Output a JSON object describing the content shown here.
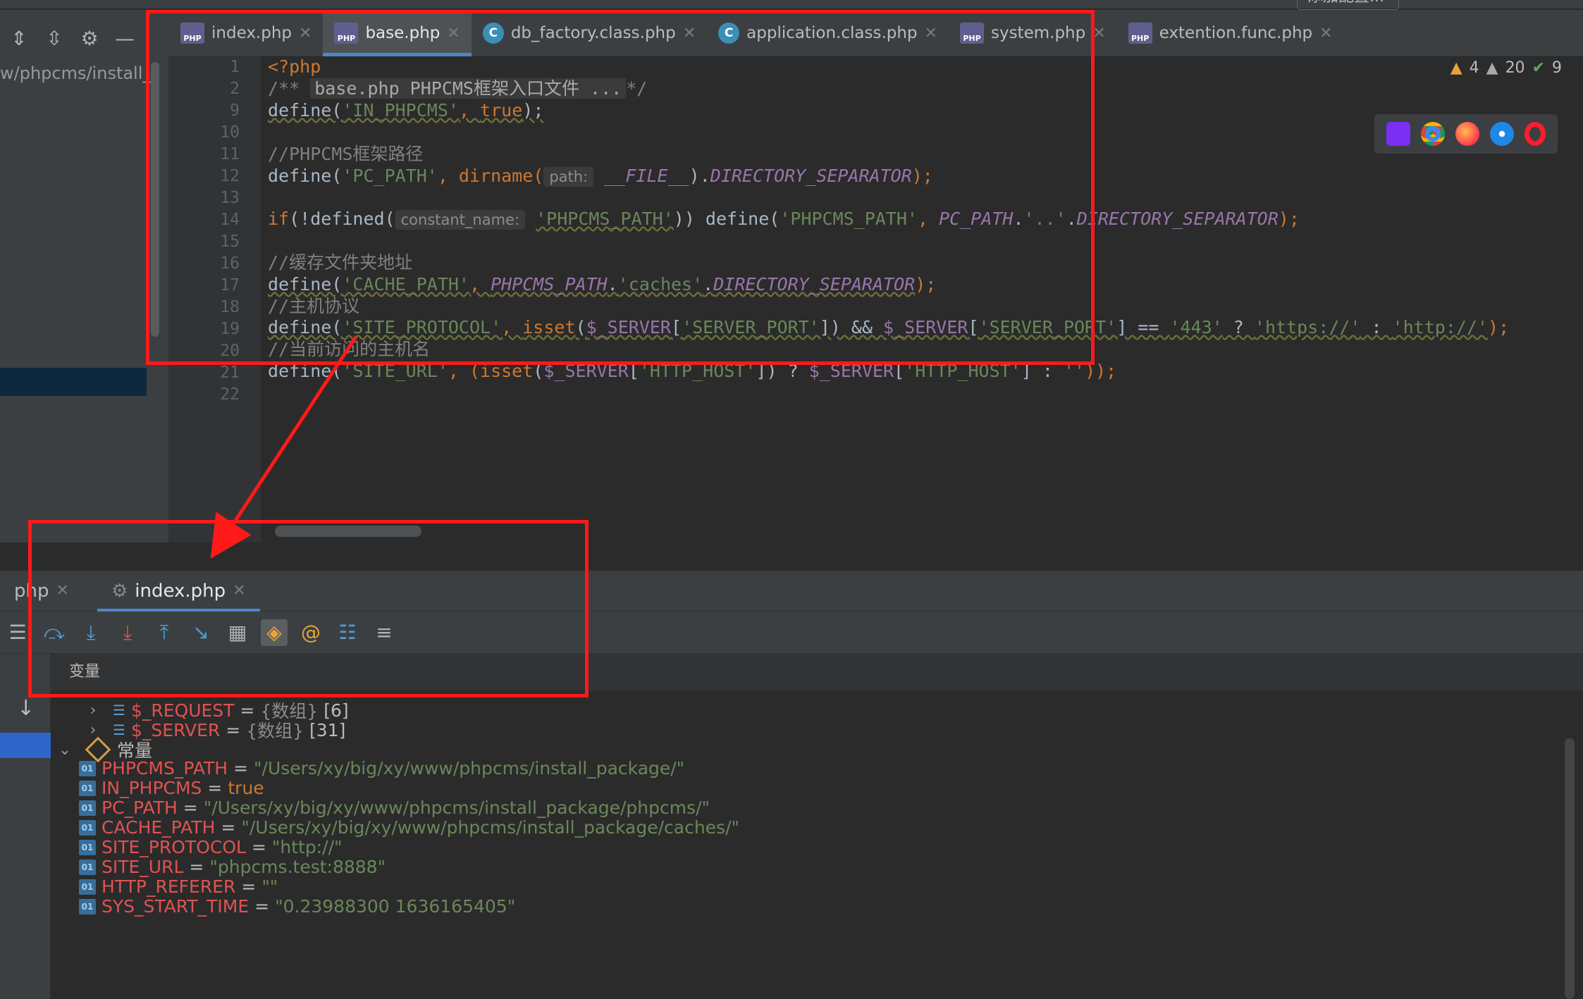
{
  "toolbar": {
    "top_button": "添加配置..."
  },
  "tabs": [
    {
      "label": "index.php",
      "type": "php"
    },
    {
      "label": "base.php",
      "type": "php",
      "active": true
    },
    {
      "label": "db_factory.class.php",
      "type": "class"
    },
    {
      "label": "application.class.php",
      "type": "class"
    },
    {
      "label": "system.php",
      "type": "php"
    },
    {
      "label": "extention.func.php",
      "type": "php"
    }
  ],
  "project": {
    "path": "w/phpcms/install_"
  },
  "editor": {
    "line_numbers": [
      "1",
      "2",
      "9",
      "10",
      "11",
      "12",
      "13",
      "14",
      "15",
      "16",
      "17",
      "18",
      "19",
      "20",
      "21",
      "22"
    ],
    "inspect": {
      "warnings": "4",
      "weak_warnings": "20",
      "ok": "9"
    },
    "fold_text": "base.php PHPCMS框架入口文件 ...",
    "hints": {
      "path": "path:",
      "constant_name": "constant_name:"
    },
    "lines": {
      "l1": "<?php",
      "l3_a": "define(",
      "l3_b": "'IN_PHPCMS'",
      ", ": ", ",
      "l3_c": "true",
      "l3_d": ");",
      "l11": "//PHPCMS框架路径",
      "l12_a": "define(",
      "l12_b": "'PC_PATH'",
      "l12_c": ", dirname(",
      "l12_d": "__FILE__",
      "l12_e": ").",
      "l12_f": "DIRECTORY_SEPARATOR",
      "l12_g": ");",
      "l14_a": "if",
      "l14_b": "(!defined(",
      "l14_c": "'PHPCMS_PATH'",
      "l14_d": ")) define(",
      "l14_e": "'PHPCMS_PATH'",
      "l14_f": ", ",
      "l14_g": "PC_PATH",
      "l14_h": ".",
      "l14_i": "'..'",
      "l14_j": ".",
      "l14_k": "DIRECTORY_SEPARATOR",
      "l14_l": ");",
      "l16": "//缓存文件夹地址",
      "l17_a": "define(",
      "l17_b": "'CACHE_PATH'",
      "l17_c": ", ",
      "l17_d": "PHPCMS_PATH",
      "l17_e": ".",
      "l17_f": "'caches'",
      "l17_g": ".",
      "l17_h": "DIRECTORY_SEPARATOR",
      "l17_i": ");",
      "l18": "//主机协议",
      "l19_a": "define(",
      "l19_b": "'SITE_PROTOCOL'",
      "l19_c": ", ",
      "l19_d": "isset",
      "l19_e": "(",
      "l19_f": "$_SERVER",
      "l19_g": "[",
      "l19_h": "'SERVER_PORT'",
      "l19_i": "]) && ",
      "l19_j": "$_SERVER",
      "l19_k": "[",
      "l19_l": "'SERVER_PORT'",
      "l19_m": "] == ",
      "l19_n": "'443'",
      "l19_o": " ? ",
      "l19_p": "'https://'",
      "l19_q": " : ",
      "l19_r": "'http://'",
      "l19_s": ");",
      "l20": "//当前访问的主机名",
      "l21_a": "define(",
      "l21_b": "'SITE_URL'",
      "l21_c": ", (",
      "l21_d": "isset",
      "l21_e": "(",
      "l21_f": "$_SERVER",
      "l21_g": "[",
      "l21_h": "'HTTP_HOST'",
      "l21_i": "]) ? ",
      "l21_j": "$_SERVER",
      "l21_k": "[",
      "l21_l": "'HTTP_HOST'",
      "l21_m": "] : ",
      "l21_n": "''",
      "l21_o": "));"
    }
  },
  "debug": {
    "tabs": [
      "php",
      "index.php"
    ],
    "vars_header": "变量",
    "rows": [
      {
        "name": "$_REQUEST",
        "eq": " = ",
        "type": "{数组}",
        "count": " [6]"
      },
      {
        "name": "$_SERVER",
        "eq": " = ",
        "type": "{数组}",
        "count": " [31]"
      }
    ],
    "constants_label": "常量",
    "constants": [
      {
        "name": "PHPCMS_PATH",
        "value": "\"/Users/xy/big/xy/www/phpcms/install_package/\"",
        "kind": "str"
      },
      {
        "name": "IN_PHPCMS",
        "value": "true",
        "kind": "bool"
      },
      {
        "name": "PC_PATH",
        "value": "\"/Users/xy/big/xy/www/phpcms/install_package/phpcms/\"",
        "kind": "str"
      },
      {
        "name": "CACHE_PATH",
        "value": "\"/Users/xy/big/xy/www/phpcms/install_package/caches/\"",
        "kind": "str"
      },
      {
        "name": "SITE_PROTOCOL",
        "value": "\"http://\"",
        "kind": "str"
      },
      {
        "name": "SITE_URL",
        "value": "\"phpcms.test:8888\"",
        "kind": "str"
      },
      {
        "name": "HTTP_REFERER",
        "value": "\"\"",
        "kind": "str"
      },
      {
        "name": "SYS_START_TIME",
        "value": "\"0.23988300 1636165405\"",
        "kind": "str"
      }
    ],
    "eq": " = "
  },
  "colors": {
    "annotation": "#ff1a1a",
    "accent": "#4a88c7"
  }
}
